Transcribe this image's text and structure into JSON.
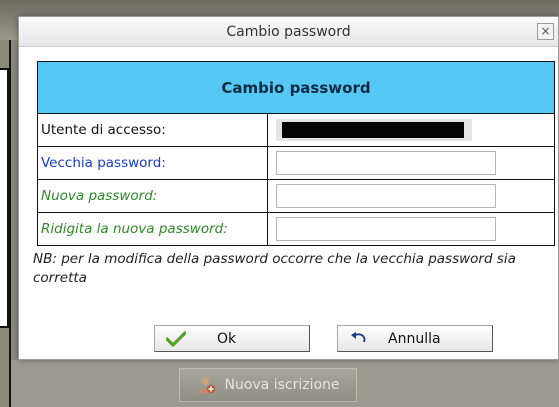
{
  "background": {
    "button_label": "Nuova iscrizione",
    "button_icon": "user-add-icon"
  },
  "dialog": {
    "title": "Cambio password",
    "close_glyph": "×",
    "header": "Cambio password",
    "fields": [
      {
        "label": "Utente di accesso:",
        "value": "",
        "masked": true
      },
      {
        "label": "Vecchia password:",
        "value": "",
        "placeholder": ""
      },
      {
        "label": "Nuova password:",
        "value": "",
        "placeholder": ""
      },
      {
        "label": "Ridigita la nuova password:",
        "value": "",
        "placeholder": ""
      }
    ],
    "note": "NB: per la modifica della password occorre che la vecchia password sia corretta",
    "ok_label": "Ok",
    "ok_icon": "checkmark-icon",
    "cancel_label": "Annulla",
    "cancel_icon": "undo-arrow-icon"
  },
  "colors": {
    "header_bg": "#55c8f6",
    "label_blue": "#1a3cc8",
    "label_green": "#2d8a26",
    "check_green": "#5aa02c"
  }
}
